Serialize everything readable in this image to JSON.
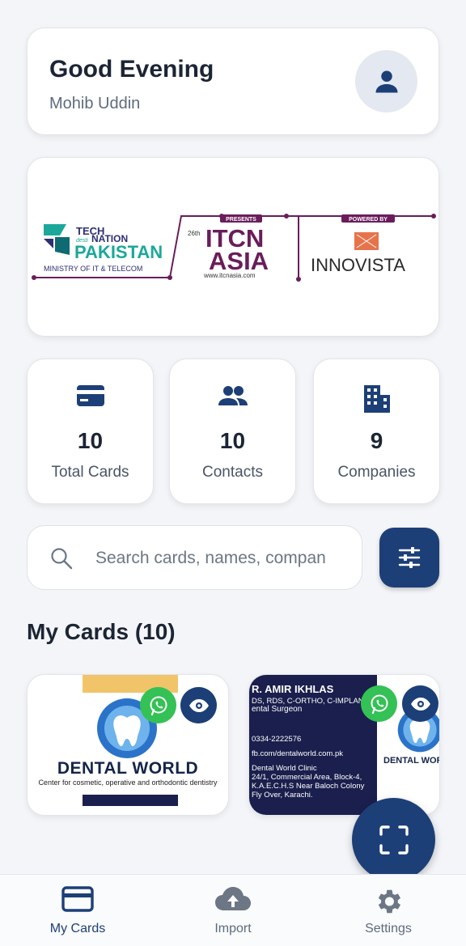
{
  "greeting": {
    "title": "Good Evening",
    "name": "Mohib Uddin"
  },
  "banner": {
    "tech": "TECH",
    "desti": "desti",
    "nation": "NATION",
    "pakistan": "PAKISTAN",
    "ministry": "MINISTRY OF IT & TELECOM",
    "presents": "PRESENTS",
    "edition": "26th",
    "itcn": "ITCN",
    "asia": "ASIA",
    "url": "www.itcnasia.com",
    "powered_by": "POWERED BY",
    "innovista": "INNOVISTA"
  },
  "stats": [
    {
      "value": "10",
      "label": "Total Cards",
      "icon": "credit-card-icon"
    },
    {
      "value": "10",
      "label": "Contacts",
      "icon": "people-icon"
    },
    {
      "value": "9",
      "label": "Companies",
      "icon": "building-icon"
    }
  ],
  "search": {
    "placeholder": "Search cards, names, compan",
    "value": ""
  },
  "section": {
    "title": "My Cards (10)"
  },
  "cards": [
    {
      "title": "DENTAL WORLD",
      "subtitle": "Center for cosmetic, operative and orthodontic dentistry"
    },
    {
      "name": "R. AMIR IKHLAS",
      "degrees": "DS, RDS, C-ORTHO, C-IMPLANT)",
      "role": "ental Surgeon",
      "phone": "0334-2222576",
      "web": "fb.com/dentalworld.com.pk",
      "clinic": "Dental World Clinic",
      "addr1": "24/1, Commercial Area, Block-4,",
      "addr2": "K.A.E.C.H.S Near Baloch Colony",
      "addr3": "Fly Over, Karachi.",
      "brand": "DENTAL WORLI"
    }
  ],
  "nav": [
    {
      "label": "My Cards",
      "icon": "card-icon",
      "active": true
    },
    {
      "label": "Import",
      "icon": "cloud-upload-icon",
      "active": false
    },
    {
      "label": "Settings",
      "icon": "gear-icon",
      "active": false
    }
  ],
  "colors": {
    "primary": "#1d3f77",
    "whatsapp": "#34c155",
    "background": "#f4f5f8"
  }
}
